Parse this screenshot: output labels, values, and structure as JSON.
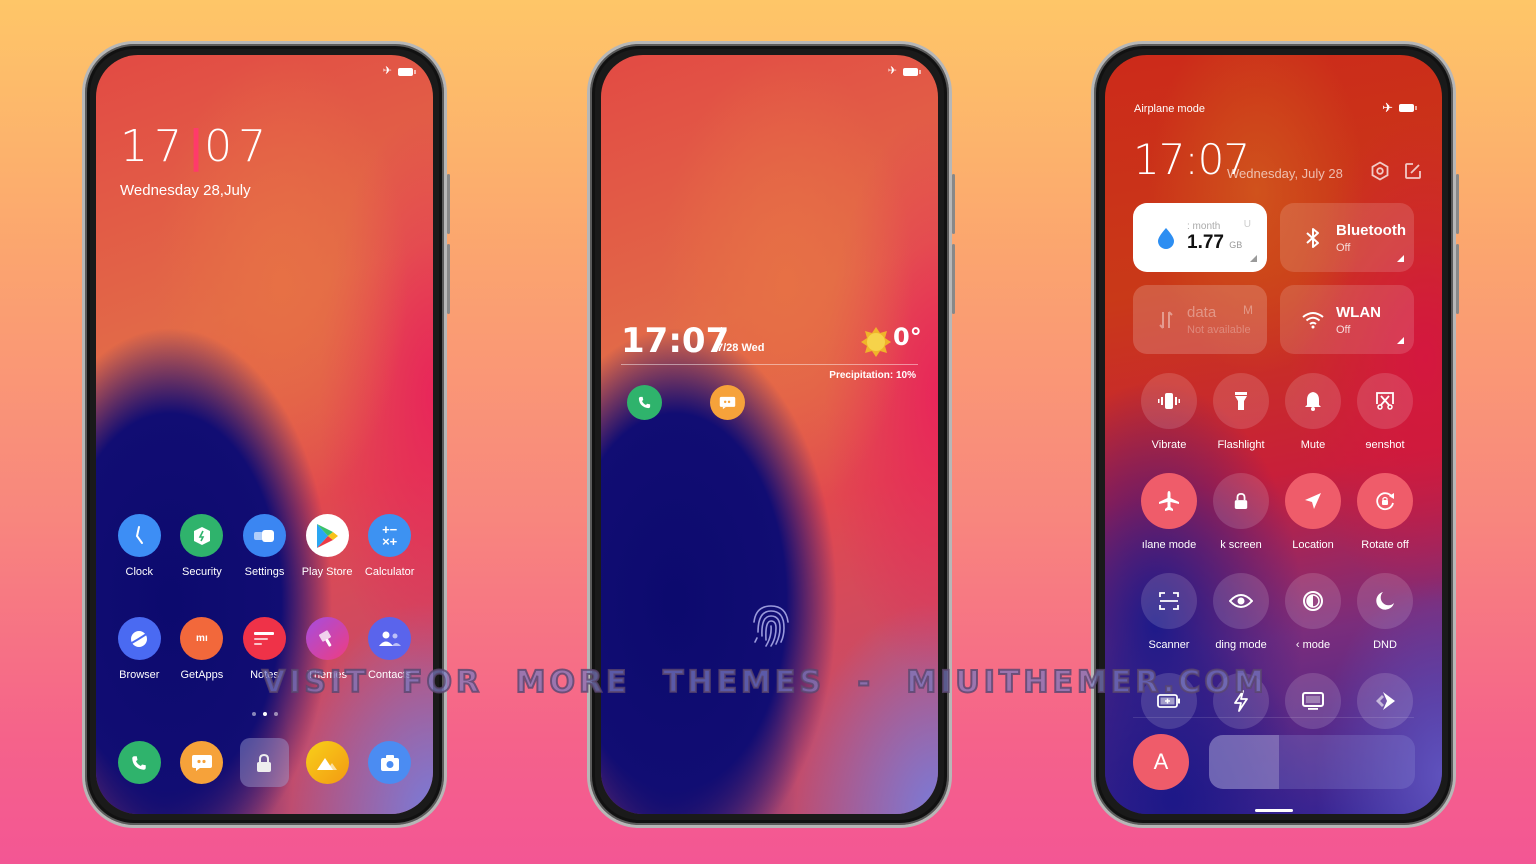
{
  "colors": {
    "page_gradient_top": "#fec668",
    "page_gradient_bottom": "#f35694",
    "accent_on_toggle": "#ef5c6a",
    "clock_separator": "#ff3a6a"
  },
  "home_screen": {
    "status": {
      "airplane_icon": "airplane-icon",
      "battery_icon": "battery-icon"
    },
    "clock": {
      "hours": "17",
      "separator": "|",
      "minutes": "07"
    },
    "date": "Wednesday 28,July",
    "apps_row1": [
      {
        "label": "Clock",
        "icon": "clock-icon",
        "color": "#3d8ef5"
      },
      {
        "label": "Security",
        "icon": "security-icon",
        "color": "#2fb36c"
      },
      {
        "label": "Settings",
        "icon": "settings-icon",
        "color": "#3b86f2"
      },
      {
        "label": "Play Store",
        "icon": "play-store-icon",
        "color": "#ffffff"
      },
      {
        "label": "Calculator",
        "icon": "calculator-icon",
        "color": "#3d92f2"
      }
    ],
    "apps_row2": [
      {
        "label": "Browser",
        "icon": "browser-icon",
        "color": "#4a6af2"
      },
      {
        "label": "GetApps",
        "icon": "getapps-icon",
        "color": "#f2683b"
      },
      {
        "label": "Notes",
        "icon": "notes-icon",
        "color": "#ef3248"
      },
      {
        "label": "Themes",
        "icon": "themes-icon",
        "color": "#c14bc8"
      },
      {
        "label": "Contacts",
        "icon": "contacts-icon",
        "color": "#5a64ec"
      }
    ],
    "page_indicator": {
      "pages": 3,
      "active": 2
    },
    "dock": [
      {
        "icon": "phone-icon",
        "color": "#2fb36c"
      },
      {
        "icon": "messages-icon",
        "color": "#f6a23a"
      },
      {
        "icon": "lock-icon",
        "color": "#8c8cc8"
      },
      {
        "icon": "gallery-icon",
        "color": "#f6b512"
      },
      {
        "icon": "camera-icon",
        "color": "#4b8cf2"
      }
    ]
  },
  "lock_screen": {
    "time": "17:07",
    "date": "7/28 Wed",
    "temperature": "0°",
    "weather_icon": "sun-icon",
    "precipitation": "Precipitation: 10%",
    "shortcuts": [
      {
        "icon": "phone-icon",
        "color": "#2fb36c"
      },
      {
        "icon": "messages-icon",
        "color": "#f6a23a"
      }
    ],
    "fingerprint_icon": "fingerprint-icon"
  },
  "control_center": {
    "header_label": "Airplane mode",
    "time": "17:07",
    "date": "Wednesday, July 28",
    "tiles": [
      {
        "name": "data-usage",
        "title": "1.77",
        "unit": "GB",
        "sub": ": month",
        "extra": "U",
        "icon": "water-drop-icon"
      },
      {
        "name": "bluetooth",
        "title": "Bluetooth",
        "sub": "Off",
        "icon": "bluetooth-icon"
      },
      {
        "name": "mobile-data",
        "title": "data",
        "sub": "Not available",
        "extra": "M",
        "icon": "mobile-data-icon"
      },
      {
        "name": "wlan",
        "title": "WLAN",
        "sub": "Off",
        "icon": "wifi-icon"
      }
    ],
    "toggles": [
      {
        "label": "Vibrate",
        "icon": "vibrate-icon",
        "on": false
      },
      {
        "label": "Flashlight",
        "icon": "flashlight-icon",
        "on": false
      },
      {
        "label": "Mute",
        "icon": "bell-icon",
        "on": false
      },
      {
        "label": "ɘenshot",
        "icon": "screenshot-icon",
        "on": false
      },
      {
        "label": "ılane mode",
        "icon": "airplane-icon",
        "on": true
      },
      {
        "label": "k screen",
        "icon": "lock-icon",
        "on": false
      },
      {
        "label": "Location",
        "icon": "location-icon",
        "on": true
      },
      {
        "label": "Rotate off",
        "icon": "rotate-lock-icon",
        "on": true
      },
      {
        "label": "Scanner",
        "icon": "scanner-icon",
        "on": false
      },
      {
        "label": "ding mode",
        "icon": "eye-icon",
        "on": false
      },
      {
        "label": "‹ mode",
        "icon": "dark-mode-icon",
        "on": false
      },
      {
        "label": "DND",
        "icon": "moon-icon",
        "on": false
      },
      {
        "label": "",
        "icon": "battery-saver-icon",
        "on": false
      },
      {
        "label": "",
        "icon": "performance-icon",
        "on": false
      },
      {
        "label": "",
        "icon": "cast-icon",
        "on": false
      },
      {
        "label": "",
        "icon": "mi-share-icon",
        "on": false
      }
    ],
    "auto_brightness_label": "A",
    "brightness_percent": 34
  },
  "watermark": "VISIT FOR MORE THEMES - MIUITHEMER.COM"
}
